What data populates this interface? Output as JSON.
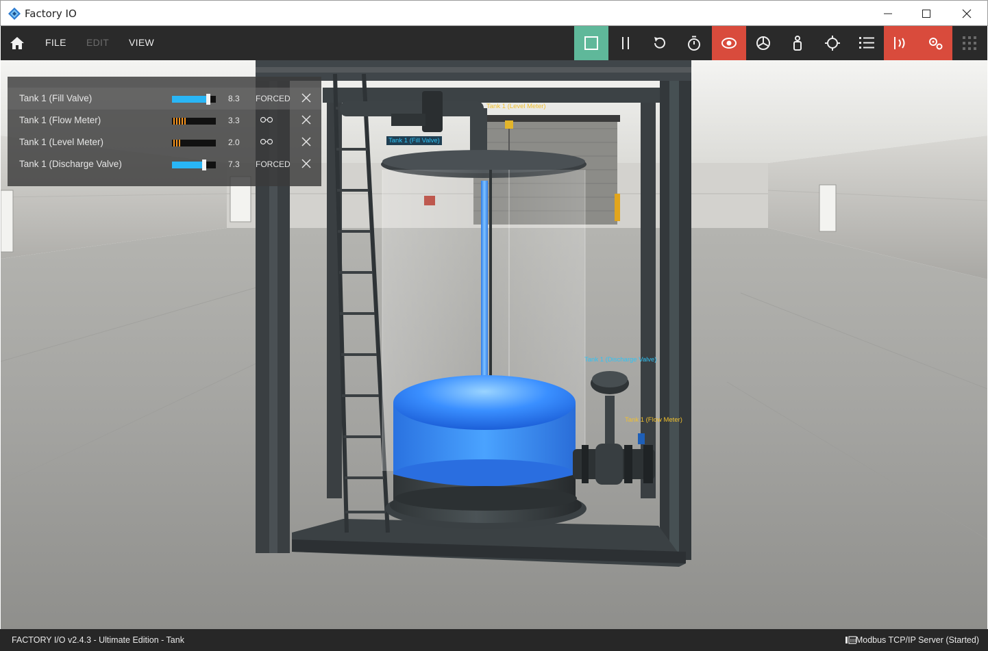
{
  "window": {
    "title": "Factory IO",
    "controls": [
      "minimize-icon",
      "maximize-icon",
      "close-icon"
    ]
  },
  "menu": {
    "home_icon": "home-icon",
    "items": [
      {
        "label": "FILE",
        "enabled": true
      },
      {
        "label": "EDIT",
        "enabled": false
      },
      {
        "label": "VIEW",
        "enabled": true
      }
    ]
  },
  "toolbar": {
    "tools": [
      {
        "icon": "stop-icon",
        "active": true,
        "color": "#5fb89a"
      },
      {
        "icon": "pause-icon",
        "active": false
      },
      {
        "icon": "reset-icon",
        "active": false
      },
      {
        "icon": "timer-icon",
        "active": false
      },
      {
        "icon": "camera-orbit-icon",
        "active": true,
        "color": "#d94b3c"
      },
      {
        "icon": "camera-fly-icon",
        "active": false
      },
      {
        "icon": "first-person-icon",
        "active": false
      },
      {
        "icon": "crosshair-icon",
        "active": false
      },
      {
        "icon": "list-icon",
        "active": false
      },
      {
        "icon": "sensors-icon",
        "active": true,
        "color": "#d94b3c"
      },
      {
        "icon": "drivers-icon",
        "active": true,
        "color": "#d94b3c"
      },
      {
        "icon": "grid-icon",
        "active": false
      }
    ]
  },
  "tag_panel": {
    "rows": [
      {
        "label": "Tank 1 (Fill Valve)",
        "kind": "slider",
        "value": "8.3",
        "level": 0.83,
        "state": "FORCED",
        "selected": true
      },
      {
        "label": "Tank 1 (Flow Meter)",
        "kind": "meter",
        "value": "3.3",
        "level": 0.33,
        "state_icon": "watch-glasses-icon",
        "selected": false
      },
      {
        "label": "Tank 1 (Level Meter)",
        "kind": "meter",
        "value": "2.0",
        "level": 0.2,
        "state_icon": "watch-glasses-icon",
        "selected": false
      },
      {
        "label": "Tank 1 (Discharge Valve)",
        "kind": "slider",
        "value": "7.3",
        "level": 0.73,
        "state": "FORCED",
        "selected": false
      }
    ],
    "colors": {
      "slider": "#29b6f6",
      "meter": "#f7941d"
    }
  },
  "scene_labels": {
    "fill_valve": "Tank 1 (Fill Valve)",
    "level_meter": "Tank 1 (Level Meter)",
    "discharge_valve": "Tank 1 (Discharge Valve)",
    "flow_meter": "Tank 1 (Flow Meter)",
    "colors": {
      "actuator": "#2fc3f5",
      "sensor": "#f2c12e"
    }
  },
  "status": {
    "version": "FACTORY I/O v2.4.3 - Ultimate Edition - Tank",
    "server": "Modbus TCP/IP Server (Started)",
    "server_icon": "server-icon"
  }
}
